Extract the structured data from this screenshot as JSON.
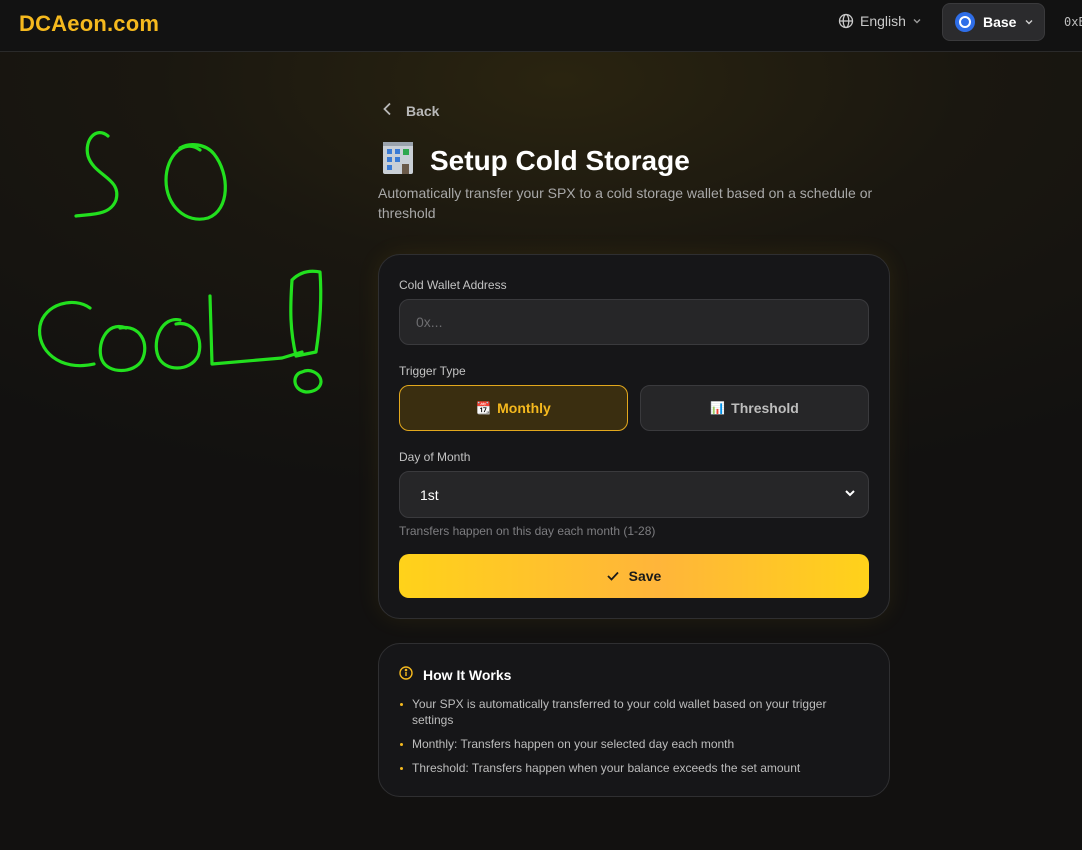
{
  "header": {
    "logo": "DCAeon.com",
    "language": "English",
    "network": "Base",
    "address": "0xB"
  },
  "doodle": {
    "text_line1": "SO",
    "text_line2": "COOL!",
    "color": "#22e01e"
  },
  "page": {
    "back_label": "Back",
    "title_emoji": "🏢",
    "title": "Setup Cold Storage",
    "subtitle": "Automatically transfer your SPX to a cold storage wallet based on a schedule or threshold"
  },
  "form": {
    "wallet_label": "Cold Wallet Address",
    "wallet_placeholder": "0x...",
    "wallet_value": "",
    "trigger_label": "Trigger Type",
    "trigger_options": [
      {
        "icon": "📆",
        "label": "Monthly",
        "selected": true
      },
      {
        "icon": "📊",
        "label": "Threshold",
        "selected": false
      }
    ],
    "day_label": "Day of Month",
    "day_value": "1st",
    "day_hint": "Transfers happen on this day each month (1-28)",
    "save_label": "Save"
  },
  "how_it_works": {
    "title": "How It Works",
    "items": [
      "Your SPX is automatically transferred to your cold wallet based on your trigger settings",
      "Monthly: Transfers happen on your selected day each month",
      "Threshold: Transfers happen when your balance exceeds the set amount"
    ]
  },
  "colors": {
    "accent": "#f5b91e",
    "background": "#121110",
    "card": "#161618",
    "doodle": "#22e01e"
  }
}
